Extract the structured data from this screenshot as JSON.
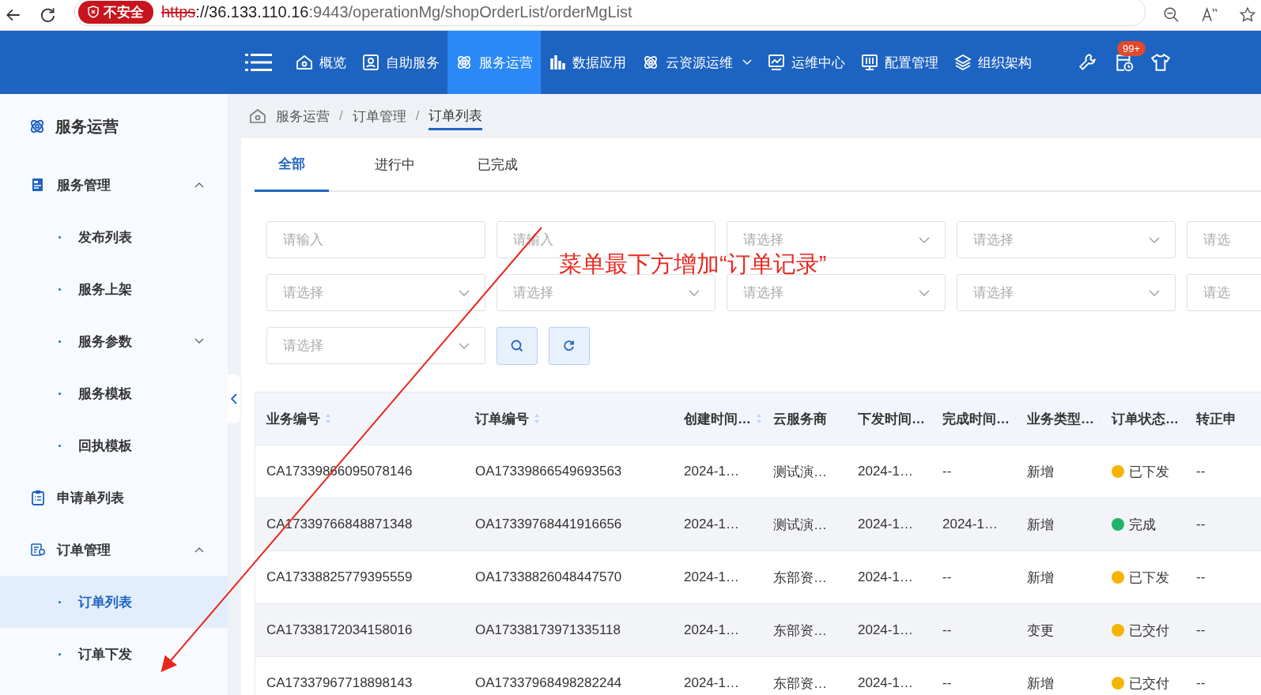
{
  "browser": {
    "security_badge": "不安全",
    "url_scheme": "https",
    "url_host": "://36.133.110.16",
    "url_rest": ":9443/operationMg/shopOrderList/orderMgList"
  },
  "nav": {
    "items": [
      {
        "label": "概览",
        "selected": false,
        "has_caret": false
      },
      {
        "label": "自助服务",
        "selected": false,
        "has_caret": false
      },
      {
        "label": "服务运营",
        "selected": true,
        "has_caret": false
      },
      {
        "label": "数据应用",
        "selected": false,
        "has_caret": false
      },
      {
        "label": "云资源运维",
        "selected": false,
        "has_caret": true
      },
      {
        "label": "运维中心",
        "selected": false,
        "has_caret": false
      },
      {
        "label": "配置管理",
        "selected": false,
        "has_caret": false
      },
      {
        "label": "组织架构",
        "selected": false,
        "has_caret": false
      }
    ],
    "badge": "99+"
  },
  "sidebar": {
    "title": "服务运营",
    "items": [
      {
        "label": "服务管理",
        "expanded": true,
        "children": [
          {
            "label": "发布列表",
            "selected": false
          },
          {
            "label": "服务上架",
            "selected": false
          },
          {
            "label": "服务参数",
            "selected": false,
            "expanded": false
          },
          {
            "label": "服务模板",
            "selected": false
          },
          {
            "label": "回执模板",
            "selected": false
          }
        ]
      },
      {
        "label": "申请单列表"
      },
      {
        "label": "订单管理",
        "expanded": true,
        "children": [
          {
            "label": "订单列表",
            "selected": true
          },
          {
            "label": "订单下发",
            "selected": false
          }
        ]
      }
    ]
  },
  "breadcrumb": {
    "separator": "/",
    "items": [
      "服务运营",
      "订单管理",
      "订单列表"
    ]
  },
  "tabs": [
    {
      "label": "全部",
      "selected": true
    },
    {
      "label": "进行中",
      "selected": false
    },
    {
      "label": "已完成",
      "selected": false
    }
  ],
  "filters": [
    [
      {
        "kind": "input",
        "placeholder": "请输入"
      },
      {
        "kind": "input",
        "placeholder": "请输入"
      },
      {
        "kind": "select",
        "placeholder": "请选择"
      },
      {
        "kind": "select",
        "placeholder": "请选择"
      },
      {
        "kind": "input",
        "placeholder": "请选"
      }
    ],
    [
      {
        "kind": "select",
        "placeholder": "请选择"
      },
      {
        "kind": "select",
        "placeholder": "请选择"
      },
      {
        "kind": "select",
        "placeholder": "请选择"
      },
      {
        "kind": "select",
        "placeholder": "请选择"
      },
      {
        "kind": "input",
        "placeholder": "请选"
      }
    ],
    [
      {
        "kind": "select",
        "placeholder": "请选择"
      }
    ]
  ],
  "table": {
    "columns": [
      {
        "label": "业务编号",
        "sortable": true
      },
      {
        "label": "订单编号",
        "sortable": true
      },
      {
        "label": "创建时间…",
        "sortable": true
      },
      {
        "label": "云服务商",
        "sortable": false
      },
      {
        "label": "下发时间…",
        "sortable": true
      },
      {
        "label": "完成时间…",
        "sortable": true
      },
      {
        "label": "业务类型…",
        "sortable": true
      },
      {
        "label": "订单状态…",
        "sortable": true
      },
      {
        "label": "转正申",
        "sortable": false
      }
    ],
    "rows": [
      {
        "cells": [
          "CA17339866095078146",
          "OA17339866549693563",
          "2024-1…",
          "测试演…",
          "2024-1…",
          "--",
          "新增"
        ],
        "status": "已下发",
        "color": "#f5b400",
        "last": "--"
      },
      {
        "cells": [
          "CA17339766848871348",
          "OA17339768441916656",
          "2024-1…",
          "测试演…",
          "2024-1…",
          "2024-1…",
          "新增"
        ],
        "status": "完成",
        "color": "#1fb36b",
        "last": "--"
      },
      {
        "cells": [
          "CA17338825779395559",
          "OA17338826048447570",
          "2024-1…",
          "东部资…",
          "2024-1…",
          "--",
          "新增"
        ],
        "status": "已下发",
        "color": "#f5b400",
        "last": "--"
      },
      {
        "cells": [
          "CA17338172034158016",
          "OA17338173971335118",
          "2024-1…",
          "东部资…",
          "2024-1…",
          "--",
          "变更"
        ],
        "status": "已交付",
        "color": "#f5b400",
        "last": "--"
      },
      {
        "cells": [
          "CA17337967718898143",
          "OA17337968498282244",
          "2024-1…",
          "东部资…",
          "2024-1…",
          "--",
          "新增"
        ],
        "status": "已交付",
        "color": "#f5b400",
        "last": "--"
      }
    ]
  },
  "annotation": {
    "text": "菜单最下方增加“订单记录”"
  }
}
